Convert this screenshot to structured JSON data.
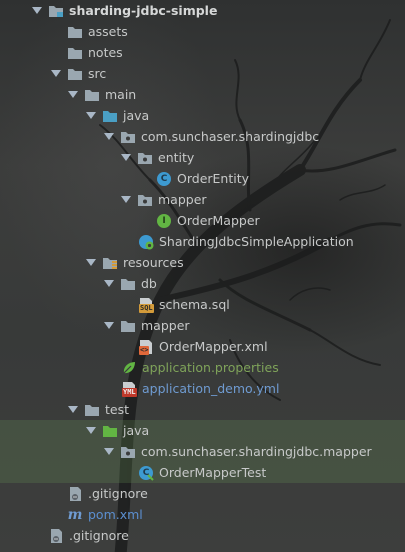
{
  "tree": {
    "project": "sharding-jdbc-simple",
    "assets": "assets",
    "notes": "notes",
    "src": "src",
    "main": "main",
    "java": "java",
    "package": "com.sunchaser.shardingjdbc",
    "entity": "entity",
    "order_entity": "OrderEntity",
    "mapper_pkg": "mapper",
    "order_mapper": "OrderMapper",
    "app_class": "ShardingJdbcSimpleApplication",
    "resources": "resources",
    "db": "db",
    "schema_sql": "schema.sql",
    "mapper_dir": "mapper",
    "order_mapper_xml": "OrderMapper.xml",
    "app_properties": "application.properties",
    "app_demo_yml": "application_demo.yml",
    "test": "test",
    "test_java": "java",
    "test_package": "com.sunchaser.shardingjdbc.mapper",
    "order_mapper_test": "OrderMapperTest",
    "module_gitignore": ".gitignore",
    "pom": "pom.xml",
    "root_gitignore": ".gitignore"
  },
  "badges": {
    "class": "C",
    "interface": "I",
    "sql": "SQL",
    "xml": "<>",
    "yml": "YML",
    "maven": "m"
  },
  "colors": {
    "folder": "#9aa7b0",
    "source_folder": "#4a9fc4",
    "test_folder": "#62b543",
    "class_icon": "#3d9ad1",
    "interface_icon": "#62b543",
    "highlight": "#5b7a4a"
  }
}
